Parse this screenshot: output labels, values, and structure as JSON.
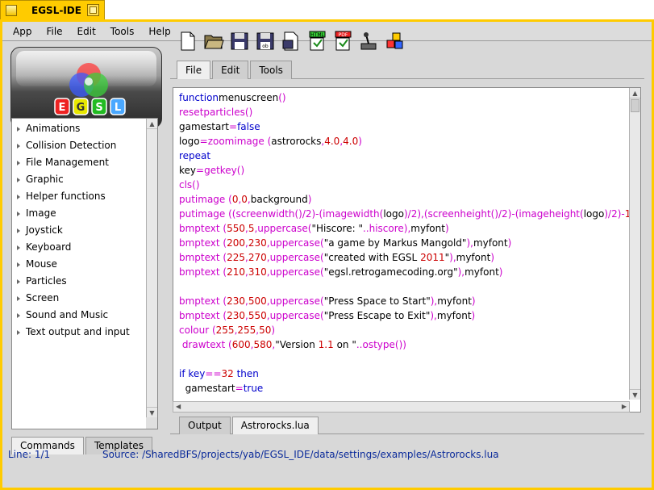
{
  "window": {
    "title": "EGSL-IDE"
  },
  "menu": {
    "items": [
      "App",
      "File",
      "Edit",
      "Tools",
      "Help"
    ]
  },
  "logo": {
    "letters": [
      "E",
      "G",
      "S",
      "L"
    ]
  },
  "commands": {
    "items": [
      "Animations",
      "Collision Detection",
      "File Management",
      "Graphic",
      "Helper functions",
      "Image",
      "Joystick",
      "Keyboard",
      "Mouse",
      "Particles",
      "Screen",
      "Sound and Music",
      "Text output and input"
    ]
  },
  "left_tabs": {
    "commands": "Commands",
    "templates": "Templates"
  },
  "toolbar": {
    "icons": [
      "new-file-icon",
      "open-folder-icon",
      "save-icon",
      "save-as-icon",
      "export-icon",
      "html-export-icon",
      "pdf-export-icon",
      "joystick-icon",
      "cubes-icon"
    ],
    "html_label": "HTML",
    "pdf_label": "PDF"
  },
  "editor_tabs": {
    "file": "File",
    "edit": "Edit",
    "tools": "Tools"
  },
  "code_lines": [
    [
      [
        "kw",
        "function"
      ],
      [
        "",
        "menuscreen"
      ],
      [
        "fn",
        "()"
      ]
    ],
    [
      [
        "fn",
        "resetparticles()"
      ]
    ],
    [
      [
        "",
        "gamestart"
      ],
      [
        "fn",
        "="
      ],
      [
        "kw",
        "false"
      ]
    ],
    [
      [
        "",
        "logo"
      ],
      [
        "fn",
        "=zoomimage"
      ],
      [
        "",
        ""
      ],
      [
        "fn",
        " ("
      ],
      [
        "",
        "astrorocks"
      ],
      [
        "fn",
        ","
      ],
      [
        "num",
        "4.0"
      ],
      [
        "fn",
        ","
      ],
      [
        "num",
        "4.0"
      ],
      [
        "fn",
        ")"
      ]
    ],
    [
      [
        "kw",
        "repeat"
      ]
    ],
    [
      [
        "",
        "key"
      ],
      [
        "fn",
        "=getkey()"
      ]
    ],
    [
      [
        "fn",
        "cls()"
      ]
    ],
    [
      [
        "fn",
        "putimage"
      ],
      [
        "fn",
        " ("
      ],
      [
        "num",
        "0"
      ],
      [
        "fn",
        ","
      ],
      [
        "num",
        "0"
      ],
      [
        "fn",
        ","
      ],
      [
        "",
        "background"
      ],
      [
        "fn",
        ")"
      ]
    ],
    [
      [
        "fn",
        "putimage ((screenwidth()/2)-(imagewidth("
      ],
      [
        "",
        "logo"
      ],
      [
        "fn",
        ")/2),(screenheight()/2)-(imageheight("
      ],
      [
        "",
        "logo"
      ],
      [
        "fn",
        ")/2)-"
      ],
      [
        "num",
        "150"
      ],
      [
        "fn",
        ","
      ],
      [
        "",
        "logo"
      ],
      [
        "fn",
        ")"
      ]
    ],
    [
      [
        "fn",
        "bmptext ("
      ],
      [
        "num",
        "550"
      ],
      [
        "fn",
        ","
      ],
      [
        "num",
        "5"
      ],
      [
        "fn",
        ",uppercase("
      ],
      [
        "str",
        "\"Hiscore: \""
      ],
      [
        "fn",
        "..hiscore),"
      ],
      [
        "",
        "myfont"
      ],
      [
        "fn",
        ")"
      ]
    ],
    [
      [
        "fn",
        "bmptext ("
      ],
      [
        "num",
        "200"
      ],
      [
        "fn",
        ","
      ],
      [
        "num",
        "230"
      ],
      [
        "fn",
        ",uppercase("
      ],
      [
        "str",
        "\"a game by Markus Mangold\""
      ],
      [
        "fn",
        "),"
      ],
      [
        "",
        "myfont"
      ],
      [
        "fn",
        ")"
      ]
    ],
    [
      [
        "fn",
        "bmptext ("
      ],
      [
        "num",
        "225"
      ],
      [
        "fn",
        ","
      ],
      [
        "num",
        "270"
      ],
      [
        "fn",
        ",uppercase("
      ],
      [
        "str",
        "\"created with EGSL "
      ],
      [
        "num",
        "2011"
      ],
      [
        "str",
        "\""
      ],
      [
        "fn",
        "),"
      ],
      [
        "",
        "myfont"
      ],
      [
        "fn",
        ")"
      ]
    ],
    [
      [
        "fn",
        "bmptext ("
      ],
      [
        "num",
        "210"
      ],
      [
        "fn",
        ","
      ],
      [
        "num",
        "310"
      ],
      [
        "fn",
        ",uppercase("
      ],
      [
        "str",
        "\"egsl.retrogamecoding.org\""
      ],
      [
        "fn",
        "),"
      ],
      [
        "",
        "myfont"
      ],
      [
        "fn",
        ")"
      ]
    ],
    [],
    [
      [
        "fn",
        "bmptext ("
      ],
      [
        "num",
        "230"
      ],
      [
        "fn",
        ","
      ],
      [
        "num",
        "500"
      ],
      [
        "fn",
        ",uppercase("
      ],
      [
        "str",
        "\"Press Space to Start\""
      ],
      [
        "fn",
        "),"
      ],
      [
        "",
        "myfont"
      ],
      [
        "fn",
        ")"
      ]
    ],
    [
      [
        "fn",
        "bmptext ("
      ],
      [
        "num",
        "230"
      ],
      [
        "fn",
        ","
      ],
      [
        "num",
        "550"
      ],
      [
        "fn",
        ",uppercase("
      ],
      [
        "str",
        "\"Press Escape to Exit\""
      ],
      [
        "fn",
        "),"
      ],
      [
        "",
        "myfont"
      ],
      [
        "fn",
        ")"
      ]
    ],
    [
      [
        "fn",
        "colour ("
      ],
      [
        "num",
        "255"
      ],
      [
        "fn",
        ","
      ],
      [
        "num",
        "255"
      ],
      [
        "fn",
        ","
      ],
      [
        "num",
        "50"
      ],
      [
        "fn",
        ")"
      ]
    ],
    [
      [
        "fn",
        " drawtext ("
      ],
      [
        "num",
        "600"
      ],
      [
        "fn",
        ","
      ],
      [
        "num",
        "580"
      ],
      [
        "fn",
        ","
      ],
      [
        "str",
        "\"Version "
      ],
      [
        "num",
        "1.1"
      ],
      [
        "str",
        " on \""
      ],
      [
        "fn",
        "..ostype())"
      ]
    ],
    [],
    [
      [
        "kw",
        "if"
      ],
      [
        "",
        ""
      ],
      [
        "kw",
        " key"
      ],
      [
        "fn",
        "=="
      ],
      [
        "num",
        "32"
      ],
      [
        "kw",
        " then"
      ]
    ],
    [
      [
        "",
        "  gamestart"
      ],
      [
        "fn",
        "="
      ],
      [
        "kw",
        "true"
      ]
    ]
  ],
  "output_tabs": {
    "output": "Output",
    "file": "Astrorocks.lua"
  },
  "status": {
    "line": "Line: 1/1",
    "source": "Source: /SharedBFS/projects/yab/EGSL_IDE/data/settings/examples/Astrorocks.lua"
  }
}
